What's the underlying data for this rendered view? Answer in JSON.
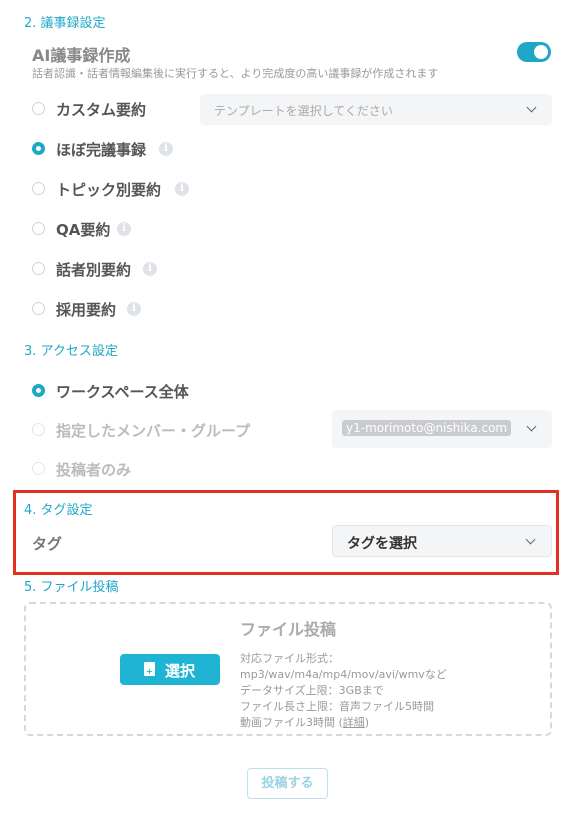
{
  "minutes": {
    "section_title": "2. 議事録設定",
    "ai_title": "AI議事録作成",
    "ai_desc": "話者認識・話者情報編集後に実行すると、より完成度の高い議事録が作成されます",
    "ai_toggle_on": true,
    "options": [
      {
        "label": "カスタム要約",
        "selected": false
      },
      {
        "label": "ほぼ完議事録",
        "selected": true
      },
      {
        "label": "トピック別要約",
        "selected": false
      },
      {
        "label": "QA要約",
        "selected": false
      },
      {
        "label": "話者別要約",
        "selected": false
      },
      {
        "label": "採用要約",
        "selected": false
      }
    ],
    "template_placeholder": "テンプレートを選択してください"
  },
  "access": {
    "section_title": "3. アクセス設定",
    "options": [
      {
        "label": "ワークスペース全体",
        "selected": true
      },
      {
        "label": "指定したメンバー・グループ",
        "selected": false
      },
      {
        "label": "投稿者のみ",
        "selected": false
      }
    ],
    "member_chip": "y1-morimoto@nishika.com"
  },
  "tags": {
    "section_title": "4. タグ設定",
    "label": "タグ",
    "select_value": "タグを選択"
  },
  "upload": {
    "section_title": "5. ファイル投稿",
    "title": "ファイル投稿",
    "select_button": "選択",
    "formats_label": "対応ファイル形式：",
    "formats": "mp3/wav/m4a/mp4/mov/avi/wmvなど",
    "size_limit": "データサイズ上限：3GBまで",
    "length_limit": "ファイル長さ上限：音声ファイル5時間",
    "video_limit": "動画ファイル3時間 (",
    "details_link": "詳細",
    "video_limit_end": ")",
    "submit": "投稿する"
  },
  "colors": {
    "accent": "#1fa7c8",
    "highlight": "#e33020"
  }
}
